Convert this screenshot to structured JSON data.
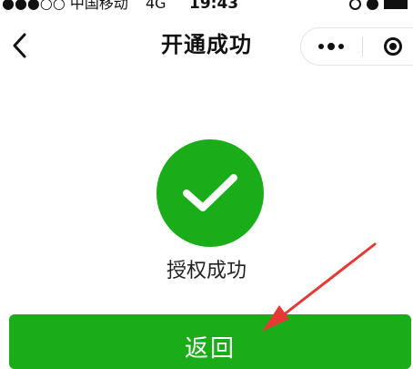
{
  "status_bar": {
    "carrier": "●●●○○ 中国移动",
    "network": "4G",
    "time": "19:43",
    "icons": [
      "rotation-lock-icon",
      "alarm-icon",
      "battery-icon"
    ]
  },
  "nav": {
    "back_icon": "chevron-left-icon",
    "title": "开通成功",
    "more_icon": "more-dots-icon",
    "close_icon": "target-close-icon"
  },
  "success": {
    "icon": "check-icon",
    "message": "授权成功"
  },
  "return_button": {
    "label": "返回"
  },
  "colors": {
    "primary_green": "#1aad19",
    "annotation_red": "#e53935",
    "text": "#111111"
  }
}
